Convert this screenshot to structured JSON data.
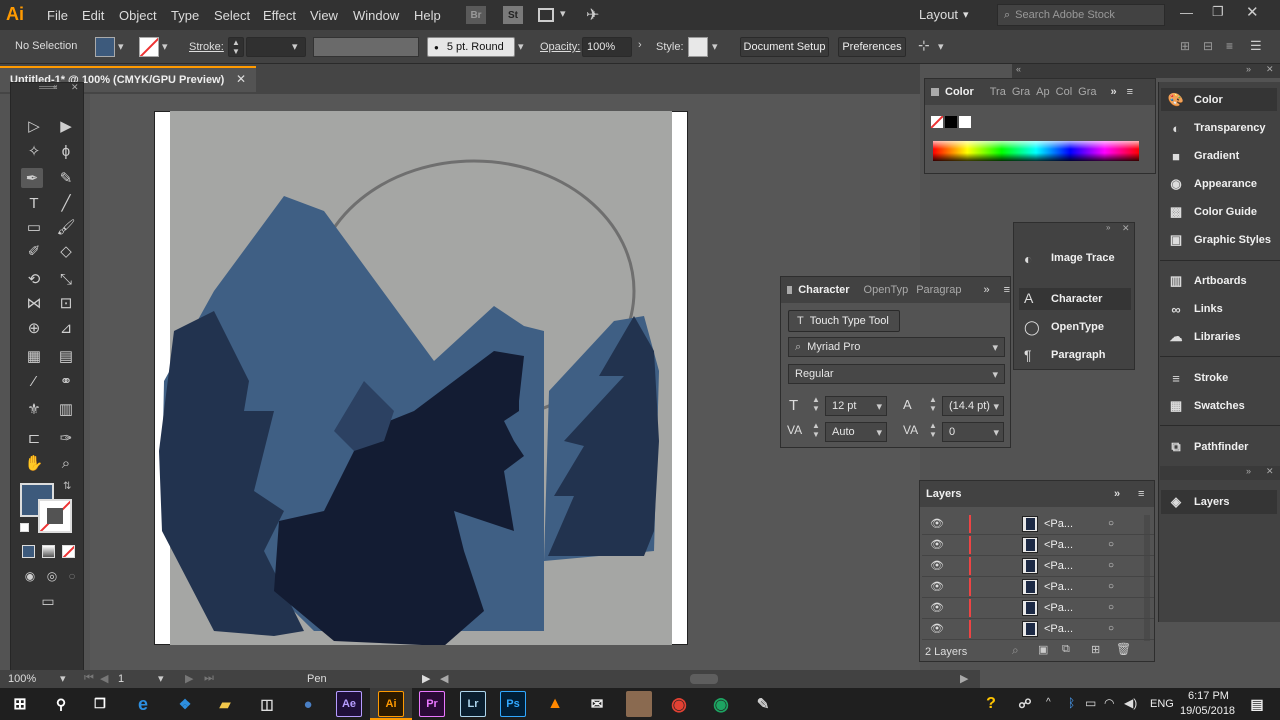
{
  "app": {
    "logo": "Ai",
    "workspace": "Layout",
    "search_placeholder": "Search Adobe Stock",
    "bridge_label": "Br",
    "stock_label": "St"
  },
  "menu": [
    "File",
    "Edit",
    "Object",
    "Type",
    "Select",
    "Effect",
    "View",
    "Window",
    "Help"
  ],
  "control": {
    "selection": "No Selection",
    "stroke_label": "Stroke:",
    "brush": "5 pt. Round",
    "opacity_label": "Opacity:",
    "opacity": "100%",
    "style_label": "Style:",
    "document_setup": "Document Setup",
    "preferences": "Preferences"
  },
  "document": {
    "tab_title": "Untitled-1* @ 100% (CMYK/GPU Preview)"
  },
  "status": {
    "zoom": "100%",
    "artboard": "1",
    "tool": "Pen"
  },
  "color_panel": {
    "title": "Color",
    "tabs": [
      "Tra",
      "Gra",
      "Ap",
      "Col",
      "Gra"
    ]
  },
  "character_panel": {
    "tabs": [
      "Character",
      "OpenTyp",
      "Paragrap"
    ],
    "touch_type": "Touch Type Tool",
    "font": "Myriad Pro",
    "style": "Regular",
    "size": "12 pt",
    "leading": "(14.4 pt)",
    "kerning": "Auto",
    "tracking": "0"
  },
  "floating_dock": {
    "items": [
      "Image Trace",
      "Character",
      "OpenType",
      "Paragraph"
    ]
  },
  "dock": {
    "items": [
      "Color",
      "Transparency",
      "Gradient",
      "Appearance",
      "Color Guide",
      "Graphic Styles",
      "Artboards",
      "Links",
      "Libraries",
      "Stroke",
      "Swatches",
      "Pathfinder",
      "Layers"
    ]
  },
  "layers_panel": {
    "title": "Layers",
    "rows": [
      "<Pa...",
      "<Pa...",
      "<Pa...",
      "<Pa...",
      "<Pa...",
      "<Pa..."
    ],
    "footer": "2 Layers"
  },
  "taskbar": {
    "apps": [
      "Ae",
      "Ai",
      "Pr",
      "Lr",
      "Ps"
    ],
    "language": "ENG",
    "time": "6:17 PM",
    "date": "19/05/2018"
  },
  "colors": {
    "accent": "#ff9a00",
    "fill": "#3d5a7c",
    "mountain": "#3f5f84",
    "tree": "#22334f",
    "wolf": "#131c33"
  }
}
